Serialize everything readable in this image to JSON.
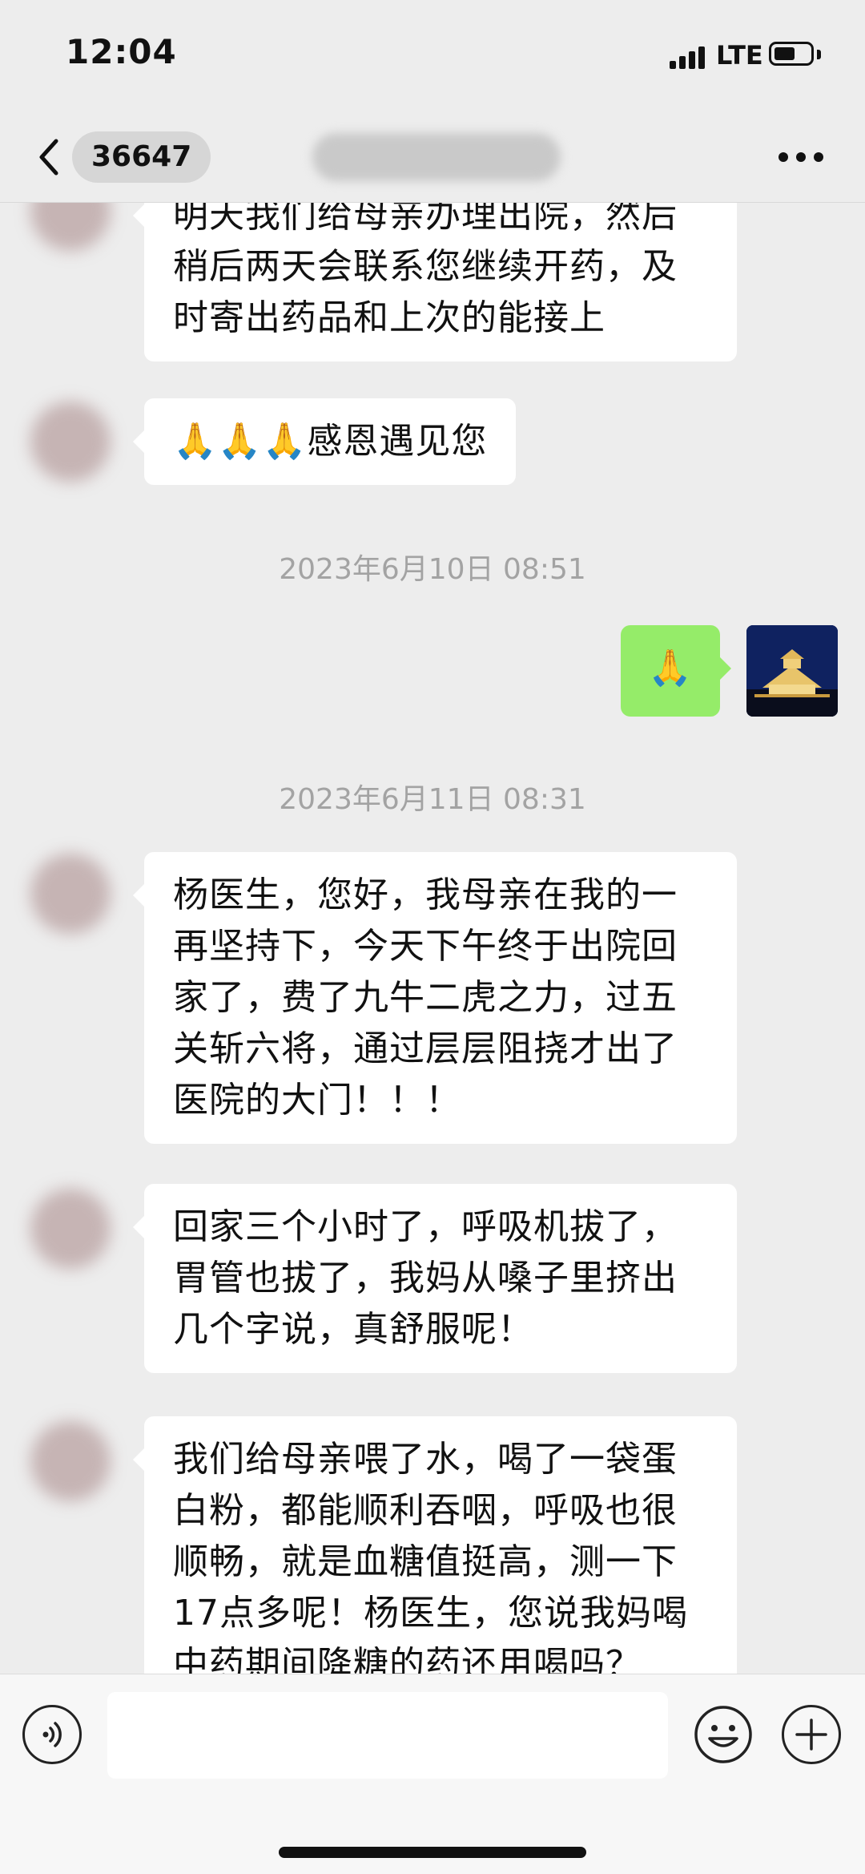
{
  "status_bar": {
    "time": "12:04",
    "network": "LTE",
    "battery_level": 0.6
  },
  "nav": {
    "unread_count": "36647"
  },
  "messages": [
    {
      "side": "left",
      "text": "明天我们给母亲办理出院，然后稍后两天会联系您继续开药，及时寄出药品和上次的能接上"
    },
    {
      "side": "left",
      "text": "🙏🙏🙏感恩遇见您"
    },
    {
      "type": "timestamp",
      "text": "2023年6月10日 08:51"
    },
    {
      "side": "right",
      "text": "🙏"
    },
    {
      "type": "timestamp",
      "text": "2023年6月11日 08:31"
    },
    {
      "side": "left",
      "text": "杨医生，您好，我母亲在我的一再坚持下，今天下午终于出院回家了，费了九牛二虎之力，过五关斩六将，通过层层阻挠才出了医院的大门！！！"
    },
    {
      "side": "left",
      "text": "回家三个小时了，呼吸机拔了，胃管也拔了，我妈从嗓子里挤出几个字说，真舒服呢！"
    },
    {
      "side": "left",
      "text": "我们给母亲喂了水，喝了一袋蛋白粉，都能顺利吞咽，呼吸也很顺畅，就是血糖值挺高，测一下17点多呢！杨医生，您说我妈喝中药期间降糖的药还用喝吗？"
    }
  ],
  "input": {
    "placeholder": ""
  },
  "colors": {
    "background": "#ededed",
    "bubble_incoming": "#ffffff",
    "bubble_outgoing": "#95ec69"
  }
}
